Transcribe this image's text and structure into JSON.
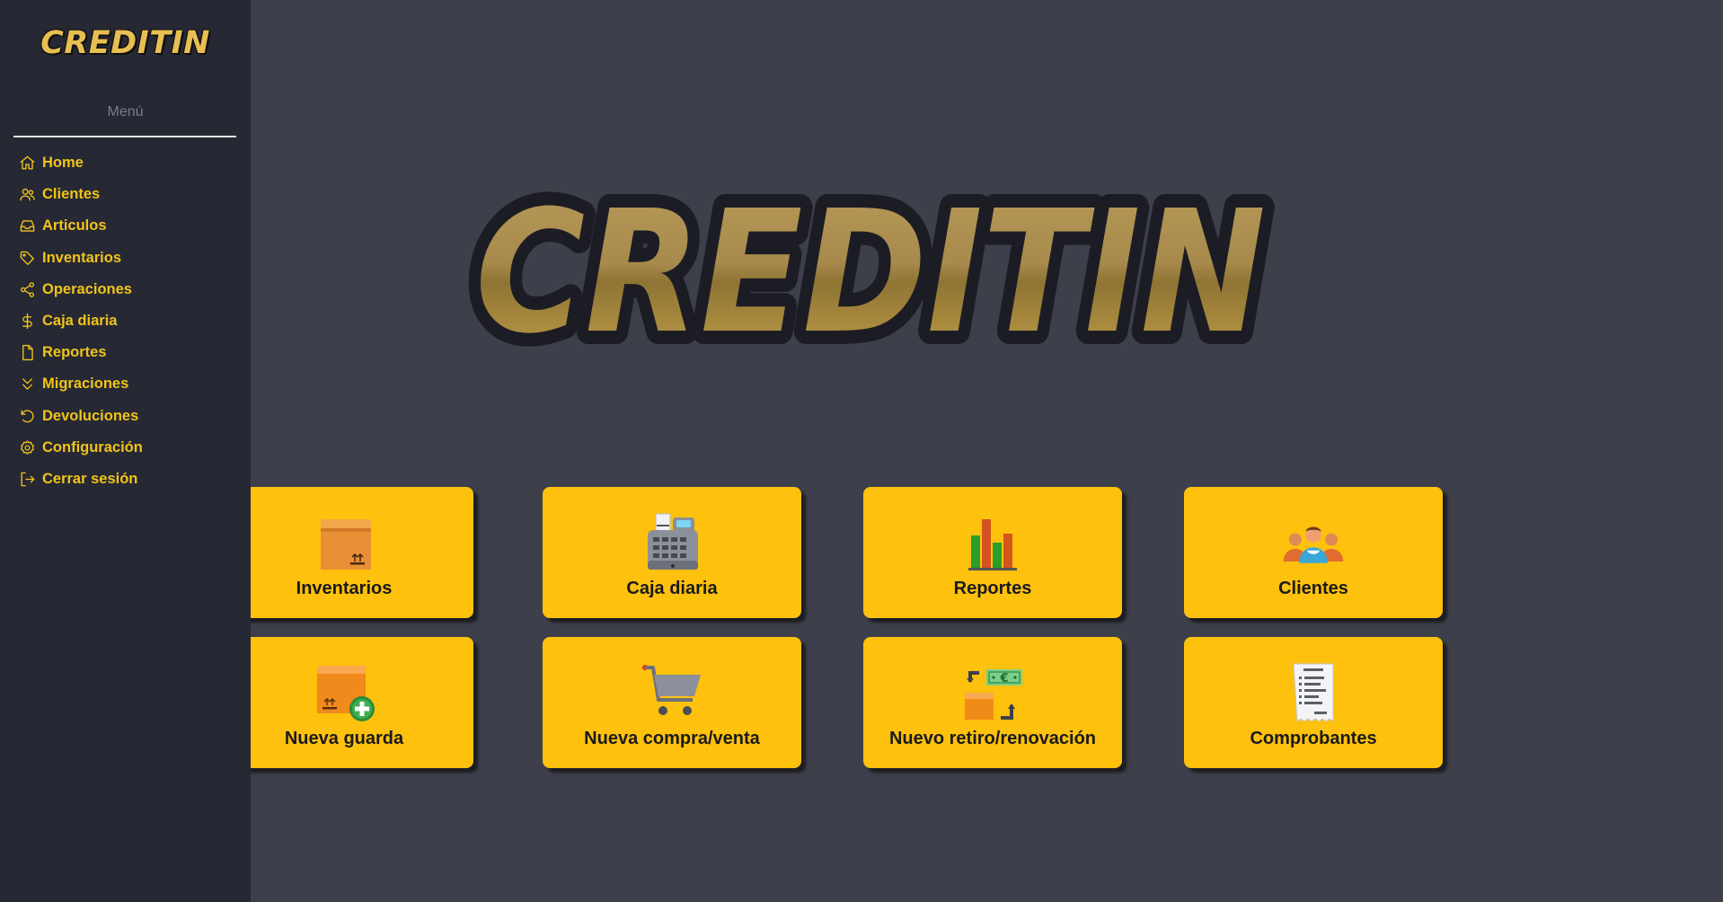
{
  "brand": {
    "name": "CREDITIN"
  },
  "sidebar": {
    "heading": "Menú",
    "items": [
      {
        "label": "Home",
        "icon": "home-icon"
      },
      {
        "label": "Clientes",
        "icon": "users-icon"
      },
      {
        "label": "Articulos",
        "icon": "inbox-icon"
      },
      {
        "label": "Inventarios",
        "icon": "tag-icon"
      },
      {
        "label": "Operaciones",
        "icon": "share-icon"
      },
      {
        "label": "Caja diaria",
        "icon": "dollar-icon"
      },
      {
        "label": "Reportes",
        "icon": "file-icon"
      },
      {
        "label": "Migraciones",
        "icon": "chevrons-down-icon"
      },
      {
        "label": "Devoluciones",
        "icon": "rotate-ccw-icon"
      },
      {
        "label": "Configuración",
        "icon": "gear-icon"
      },
      {
        "label": "Cerrar sesión",
        "icon": "logout-icon"
      }
    ]
  },
  "tiles": [
    {
      "label": "Inventarios",
      "icon": "box-icon"
    },
    {
      "label": "Caja diaria",
      "icon": "cash-register-icon"
    },
    {
      "label": "Reportes",
      "icon": "bar-chart-icon"
    },
    {
      "label": "Clientes",
      "icon": "people-group-icon"
    },
    {
      "label": "Nueva guarda",
      "icon": "box-add-icon"
    },
    {
      "label": "Nueva compra/venta",
      "icon": "shopping-cart-icon"
    },
    {
      "label": "Nuevo retiro/renovación",
      "icon": "exchange-money-icon"
    },
    {
      "label": "Comprobantes",
      "icon": "receipt-icon"
    }
  ],
  "colors": {
    "accent": "#f0c419",
    "tile": "#fec10d",
    "sidebar_bg": "#262834",
    "main_bg": "#3d3f4a"
  }
}
